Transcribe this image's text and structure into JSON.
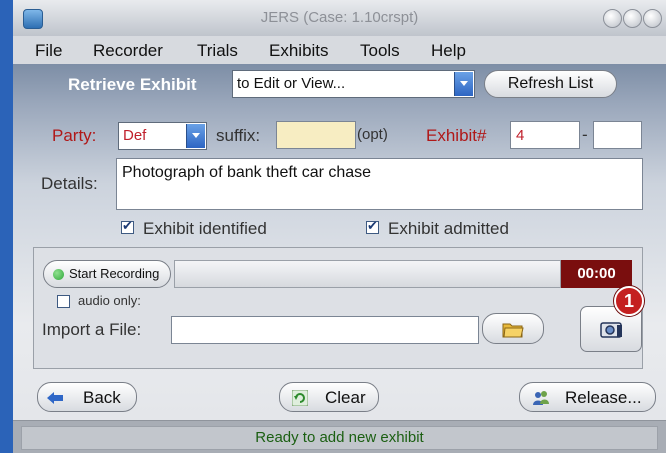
{
  "window": {
    "title": "JERS (Case: 1.10crspt)"
  },
  "menu": [
    "File",
    "Recorder",
    "Trials",
    "Exhibits",
    "Tools",
    "Help"
  ],
  "retrieve": {
    "label": "Retrieve Exhibit",
    "selected": "to Edit or View...",
    "refresh_label": "Refresh List"
  },
  "form": {
    "party_label": "Party:",
    "party_value": "Def",
    "suffix_label": "suffix:",
    "suffix_value": "",
    "opt_label": "(opt)",
    "exhibit_label": "Exhibit#",
    "exhibit_value": "4",
    "exhibit_dash": "-",
    "exhibit_sub": "",
    "details_label": "Details:",
    "details_value": "Photograph of bank theft car chase",
    "identified_label": "Exhibit identified",
    "identified_checked": true,
    "admitted_label": "Exhibit admitted",
    "admitted_checked": true
  },
  "recording": {
    "start_label": "Start Recording",
    "time": "00:00",
    "audio_only_label": "audio only:",
    "audio_only_checked": false,
    "progress": 0,
    "import_label": "Import a File:",
    "import_value": "",
    "badge": "1"
  },
  "actions": {
    "back_label": "Back",
    "clear_label": "Clear",
    "release_label": "Release..."
  },
  "status": "Ready to add new exhibit",
  "colors": {
    "accent_red": "#b01818",
    "timer_bg": "#7a0e0e",
    "status_green": "#1b5f12",
    "record_green": "#2fa83a",
    "badge_red": "#c42020"
  }
}
